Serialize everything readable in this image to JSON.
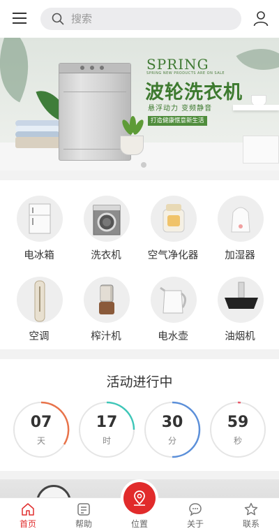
{
  "search": {
    "placeholder": "搜索"
  },
  "banner": {
    "spring": "SPRING",
    "spring_sub": "SPRING NEW PRODUCTS ARE ON SALE",
    "heading": "波轮洗衣机",
    "tagline": "悬浮动力  变频静音",
    "badge": "打造健康惬意新生活"
  },
  "categories": [
    {
      "label": "电冰箱",
      "icon": "refrigerator-icon"
    },
    {
      "label": "洗衣机",
      "icon": "washing-machine-icon"
    },
    {
      "label": "空气净化器",
      "icon": "air-purifier-icon"
    },
    {
      "label": "加湿器",
      "icon": "humidifier-icon"
    },
    {
      "label": "空调",
      "icon": "air-conditioner-icon"
    },
    {
      "label": "榨汁机",
      "icon": "juicer-icon"
    },
    {
      "label": "电水壶",
      "icon": "kettle-icon"
    },
    {
      "label": "油烟机",
      "icon": "range-hood-icon"
    }
  ],
  "activity": {
    "title": "活动进行中",
    "countdown": [
      {
        "value": "07",
        "unit": "天",
        "color": "#e8734a"
      },
      {
        "value": "17",
        "unit": "时",
        "color": "#3ec6b8"
      },
      {
        "value": "30",
        "unit": "分",
        "color": "#5b8fd9"
      },
      {
        "value": "59",
        "unit": "秒",
        "color": "#e85a6a"
      }
    ]
  },
  "nav": {
    "items": [
      {
        "label": "首页",
        "icon": "home-icon",
        "active": true
      },
      {
        "label": "帮助",
        "icon": "help-doc-icon",
        "active": false
      },
      {
        "label": "位置",
        "icon": "location-icon",
        "active": false
      },
      {
        "label": "关于",
        "icon": "chat-bubble-icon",
        "active": false
      },
      {
        "label": "联系",
        "icon": "star-icon",
        "active": false
      }
    ]
  },
  "colors": {
    "accent": "#e12b2b",
    "brand_green": "#3d7a2f"
  }
}
